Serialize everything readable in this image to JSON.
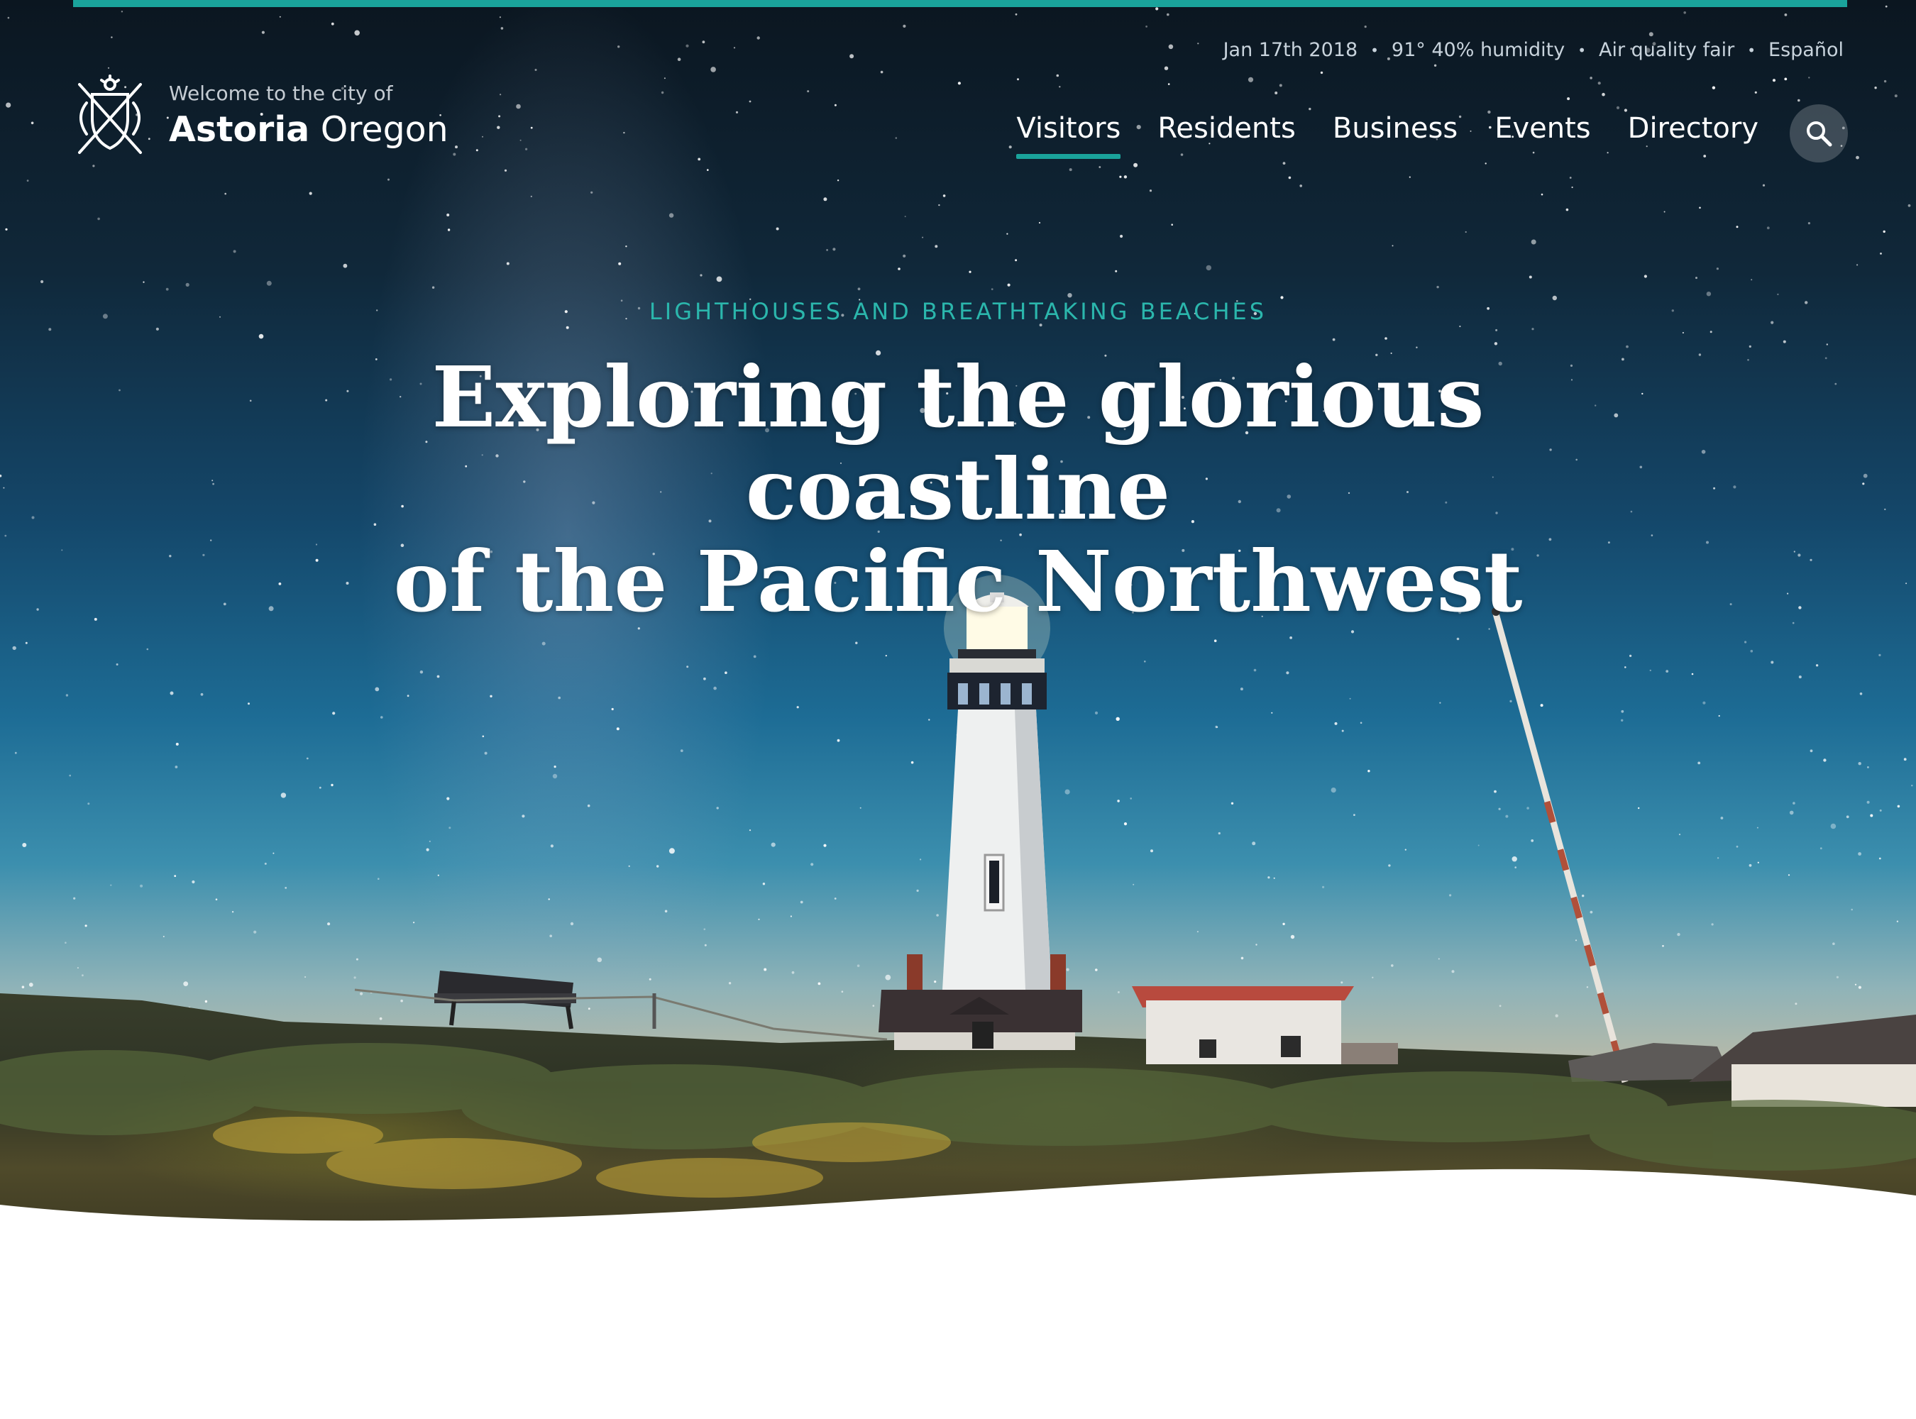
{
  "colors": {
    "accent": "#1aa39b",
    "eyebrow": "#2bb6ac",
    "text_light": "#ffffff",
    "text_muted": "#c8d3dc"
  },
  "utility": {
    "date": "Jan 17th 2018",
    "weather": "91° 40% humidity",
    "air_quality": "Air quality fair",
    "language": "Español"
  },
  "logo": {
    "crest_icon": "city-crest-icon",
    "welcome": "Welcome to the city of",
    "city_bold": "Astoria",
    "city_rest": "Oregon"
  },
  "nav": {
    "items": [
      {
        "label": "Visitors",
        "active": true
      },
      {
        "label": "Residents",
        "active": false
      },
      {
        "label": "Business",
        "active": false
      },
      {
        "label": "Events",
        "active": false
      },
      {
        "label": "Directory",
        "active": false
      }
    ],
    "search_icon": "search-icon"
  },
  "hero": {
    "eyebrow": "LIGHTHOUSES AND BREATHTAKING BEACHES",
    "headline_line1": "Exploring the glorious coastline",
    "headline_line2": "of the Pacific Northwest"
  }
}
